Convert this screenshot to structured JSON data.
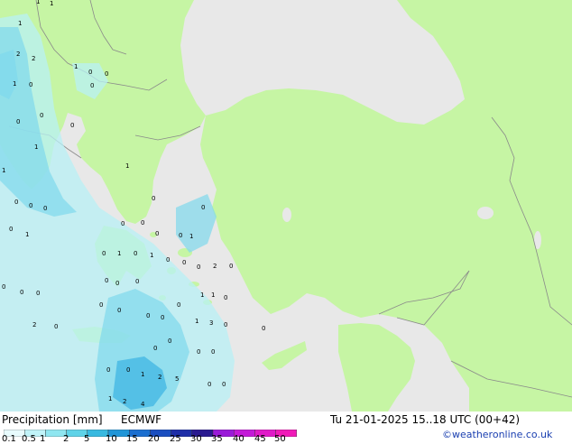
{
  "legend": {
    "title": "Precipitation [mm]",
    "model": "ECMWF",
    "datetime": "Tu 21-01-2025 15..18 UTC (00+42)",
    "credit": "©weatheronline.co.uk",
    "scale_labels": [
      "0.1",
      "0.5",
      "1",
      "2",
      "5",
      "10",
      "15",
      "20",
      "25",
      "30",
      "35",
      "40",
      "45",
      "50"
    ],
    "scale_colors": [
      "#e8fbfd",
      "#c0f3f8",
      "#8fe6f0",
      "#5fd3e8",
      "#38b9e0",
      "#2096d8",
      "#1b6fd0",
      "#1a4ec0",
      "#1f2fa8",
      "#2a1a90",
      "#9a1ad8",
      "#c41ad8",
      "#e01ac8",
      "#f01ab8"
    ]
  },
  "colors": {
    "land": "#c6f5a4",
    "sea": "#e8e8e8",
    "border": "#8a8a8a",
    "precip_light": "#b8f0f6",
    "precip_medium": "#7fd8ec",
    "precip_heavy": "#45b8e4"
  },
  "map_values": [
    "1",
    "1",
    "1",
    "2",
    "2",
    "1",
    "0",
    "0",
    "1",
    "0",
    "0",
    "0",
    "0",
    "0",
    "1",
    "1",
    "1",
    "0",
    "0",
    "0",
    "0",
    "0",
    "1",
    "0",
    "0",
    "0",
    "0",
    "1",
    "0",
    "0",
    "1",
    "0",
    "1",
    "0",
    "0",
    "0",
    "2",
    "0",
    "0",
    "0",
    "0",
    "0",
    "0",
    "0",
    "1",
    "1",
    "0",
    "0",
    "0",
    "0",
    "0",
    "0",
    "1",
    "3",
    "0",
    "0",
    "2",
    "0",
    "0",
    "0",
    "0",
    "0",
    "0",
    "1",
    "2",
    "5",
    "1",
    "2",
    "4",
    "0",
    "0",
    "0"
  ]
}
